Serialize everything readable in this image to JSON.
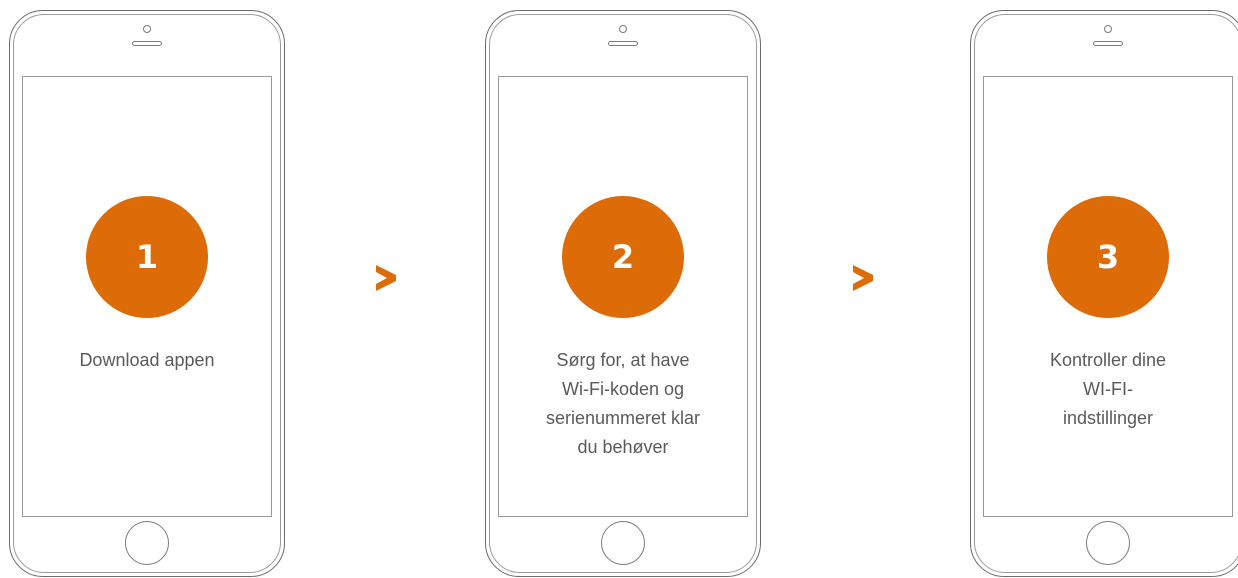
{
  "colors": {
    "accent": "#dc6b08",
    "outline": "#7a7a7a",
    "text": "#5a5a5a"
  },
  "steps": [
    {
      "number": "1",
      "text": "Download appen"
    },
    {
      "number": "2",
      "text": "Sørg for, at have\nWi-Fi-koden og\nserienummeret klar\ndu behøver"
    },
    {
      "number": "3",
      "text": "Kontroller dine\nWI-FI-\nindstillinger"
    }
  ],
  "arrow_icon": "chevron-right-icon"
}
